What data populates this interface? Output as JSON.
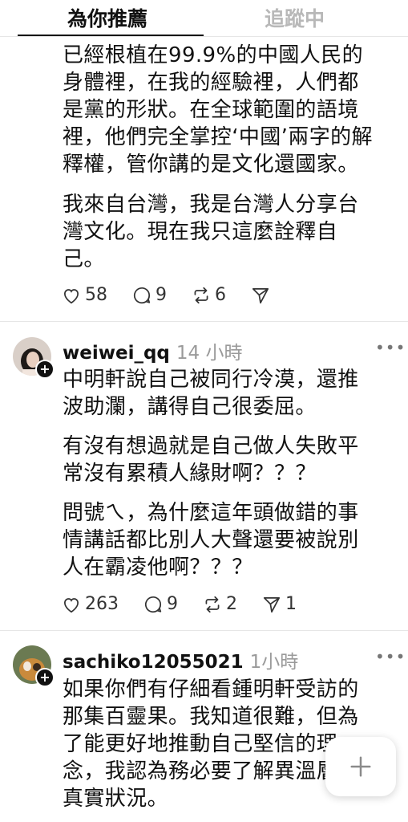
{
  "tabs": {
    "for_you": "為你推薦",
    "following": "追蹤中"
  },
  "post1": {
    "paragraphs": [
      "已經根植在99.9%的中國人民的\n身體裡，在我的經驗裡，人們都\n是黨的形狀。在全球範圍的語境\n裡，他們完全掌控‘中國’兩字的解\n釋權，管你講的是文化還國家。",
      "我來自台灣，我是台灣人分享台\n灣文化。現在我只這麼詮釋自\n己。"
    ],
    "likes": "58",
    "replies": "9",
    "reposts": "6"
  },
  "post2": {
    "username": "weiwei_qq",
    "time": "14 小時",
    "paragraphs": [
      "中明軒說自己被同行冷漠，還推\n波助瀾，講得自己很委屈。",
      "有沒有想過就是自己做人失敗平\n常沒有累積人緣財啊？？？",
      "問號ㄟ，為什麼這年頭做錯的事\n情講話都比別人大聲還要被說別\n人在霸凌他啊？？？"
    ],
    "likes": "263",
    "replies": "9",
    "reposts": "2",
    "shares": "1"
  },
  "post3": {
    "username": "sachiko12055021",
    "time": "1小時",
    "paragraphs": [
      "如果你們有仔細看鍾明軒受訪的\n那集百靈果。我知道很難，但為\n了能更好地推動自己堅信的理\n念，我認為務必要了解異溫層的\n真實狀況。"
    ]
  },
  "icons": {
    "like": "heart-icon",
    "reply": "speech-bubble-icon",
    "repost": "repost-icon",
    "share": "send-icon",
    "more": "more-dots-icon",
    "compose": "plus-icon"
  },
  "more_label": "•••",
  "follow_badge": "+"
}
